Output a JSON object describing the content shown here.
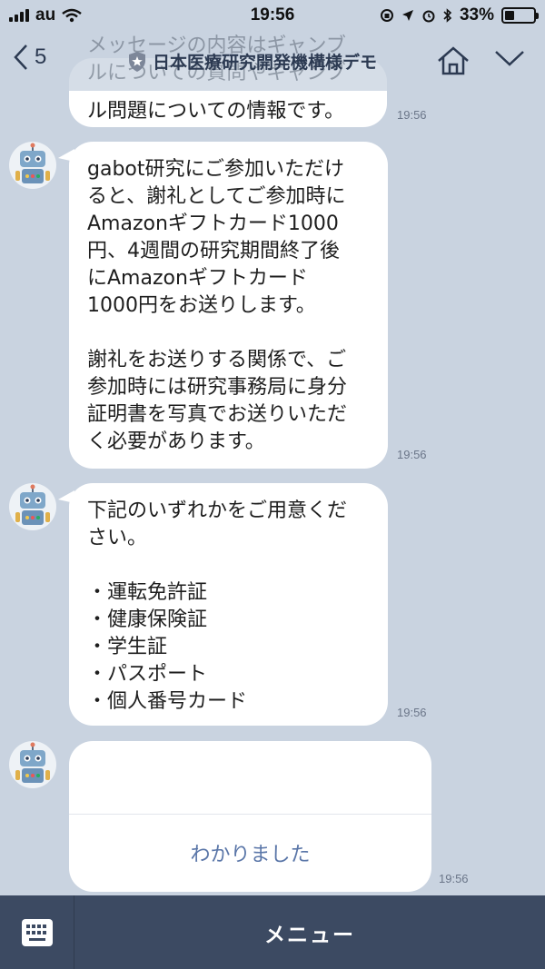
{
  "status": {
    "carrier": "au",
    "time": "19:56",
    "battery": "33%"
  },
  "nav": {
    "back_count": "5",
    "title": "日本医療研究開発機構様デモ",
    "overlay_line1": "メッセージの内容はギャンブ",
    "overlay_line2": "ルについての質問やギャンブ"
  },
  "messages": [
    {
      "text": "ル問題についての情報です。",
      "time": "19:56"
    },
    {
      "text": "gabot研究にご参加いただけ\nると、謝礼としてご参加時に\nAmazonギフトカード1000\n円、4週間の研究期間終了後\nにAmazonギフトカード\n1000円をお送りします。\n\n謝礼をお送りする関係で、ご\n参加時には研究事務局に身分\n証明書を写真でお送りいただ\nく必要があります。",
      "time": "19:56"
    },
    {
      "text": "下記のいずれかをご用意くだ\nさい。\n\n・運転免許証\n・健康保険証\n・学生証\n・パスポート\n・個人番号カード",
      "time": "19:56"
    }
  ],
  "button_card": {
    "action_label": "わかりました",
    "time": "19:56"
  },
  "bottom": {
    "menu_label": "メニュー"
  }
}
